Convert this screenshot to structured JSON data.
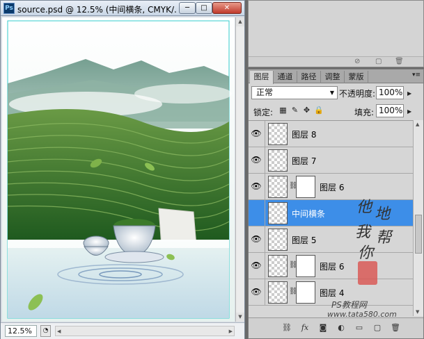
{
  "document": {
    "title": "source.psd @ 12.5% (中间横条, CMYK/...",
    "app_icon": "Ps",
    "zoom": "12.5%",
    "buttons": {
      "minimize": "─",
      "maximize": "□",
      "close": "✕"
    }
  },
  "layers_panel": {
    "tabs": [
      {
        "label": "图层",
        "active": true
      },
      {
        "label": "通道",
        "active": false
      },
      {
        "label": "路径",
        "active": false
      },
      {
        "label": "调整",
        "active": false
      },
      {
        "label": "蒙版",
        "active": false
      }
    ],
    "blend_mode": "正常",
    "opacity_label": "不透明度:",
    "opacity_value": "100%",
    "lock_label": "锁定:",
    "fill_label": "填充:",
    "fill_value": "100%",
    "layers": [
      {
        "name": "图层 8",
        "visible": true,
        "has_mask": false,
        "selected": false
      },
      {
        "name": "图层 7",
        "visible": true,
        "has_mask": false,
        "selected": false
      },
      {
        "name": "图层 6",
        "visible": true,
        "has_mask": true,
        "selected": false
      },
      {
        "name": "中间横条",
        "visible": false,
        "has_mask": false,
        "selected": true
      },
      {
        "name": "图层 5",
        "visible": true,
        "has_mask": false,
        "selected": false
      },
      {
        "name": "图层 6",
        "visible": true,
        "has_mask": true,
        "selected": false
      },
      {
        "name": "图层 4",
        "visible": true,
        "has_mask": true,
        "selected": false
      }
    ]
  },
  "watermark": {
    "chars": [
      "他",
      "地",
      "我",
      "帮",
      "你"
    ],
    "site_cn": "PS教程网",
    "url": "www.tata580.com"
  },
  "colors": {
    "selection": "#3d8ee8",
    "panel_bg": "#d6d6d6",
    "close_button": "#c0392b"
  }
}
